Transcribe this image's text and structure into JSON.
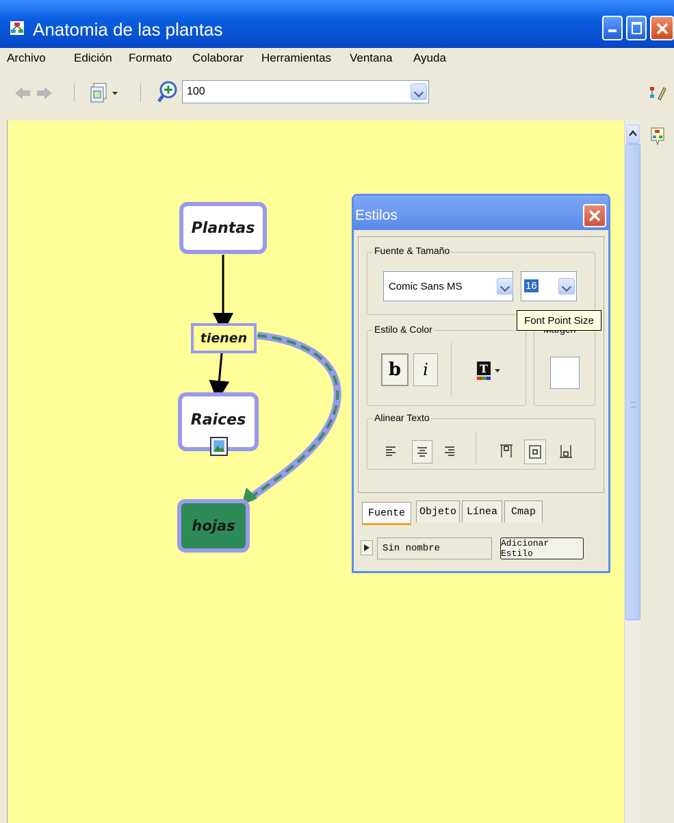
{
  "window": {
    "title": "Anatomia de las plantas"
  },
  "menu": [
    "Archivo",
    "Edición",
    "Formato",
    "Colaborar",
    "Herramientas",
    "Ventana",
    "Ayuda"
  ],
  "toolbar": {
    "zoom_value": "100"
  },
  "concepts": {
    "plantas": "Plantas",
    "tienen": "tienen",
    "raices": "Raices",
    "hojas": "hojas"
  },
  "styles_dialog": {
    "title": "Estilos",
    "font_group": "Fuente & Tamaño",
    "font_family": "Comic Sans MS",
    "font_size": "16",
    "style_group": "Estilo & Color",
    "bold_label": "b",
    "italic_label": "i",
    "margin_group": "Margen",
    "align_group": "Alinear Texto",
    "tabs": [
      "Fuente",
      "Objeto",
      "Línea",
      "Cmap"
    ],
    "style_name": "Sin nombre",
    "add_style_button": "Adicionar Estilo"
  },
  "tooltip": "Font Point Size",
  "colors": {
    "canvas": "#ffff99",
    "concept_border": "#9999ee",
    "hojas_fill": "#2e8b57",
    "link_stroke": "#3c8c5c",
    "titlebar": "#0a5fe0"
  }
}
